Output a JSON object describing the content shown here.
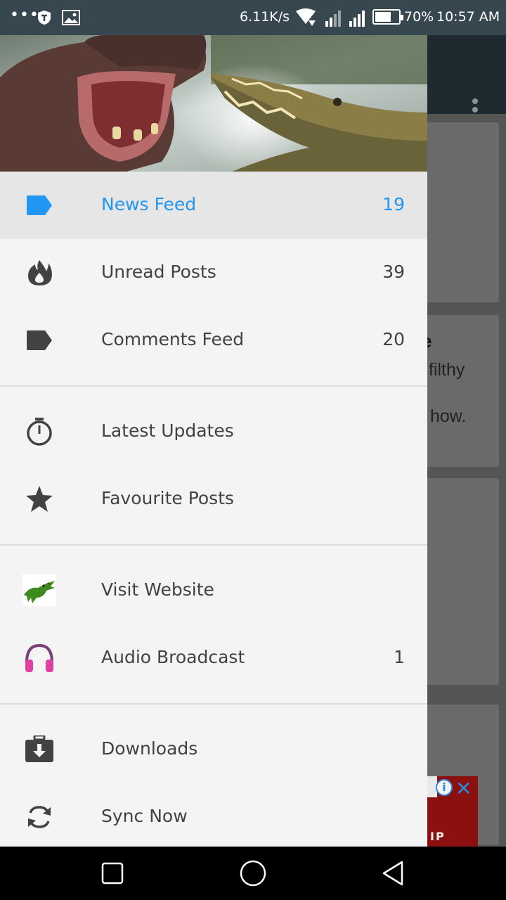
{
  "status_bar": {
    "dots": "•••",
    "network_speed": "6.11K/s",
    "battery_percent": "70%",
    "battery_level": 0.7,
    "time": "10:57 AM"
  },
  "drawer": {
    "groups": [
      [
        {
          "label": "News Feed",
          "count": "19",
          "icon": "label-tag-icon",
          "active": true
        },
        {
          "label": "Unread Posts",
          "count": "39",
          "icon": "flame-icon"
        },
        {
          "label": "Comments Feed",
          "count": "20",
          "icon": "label-tag-icon"
        }
      ],
      [
        {
          "label": "Latest Updates",
          "count": "",
          "icon": "stopwatch-icon"
        },
        {
          "label": "Favourite Posts",
          "count": "",
          "icon": "star-icon"
        }
      ],
      [
        {
          "label": "Visit Website",
          "count": "",
          "icon": "crocodile-icon"
        },
        {
          "label": "Audio Broadcast",
          "count": "1",
          "icon": "headphones-icon"
        }
      ],
      [
        {
          "label": "Downloads",
          "count": "",
          "icon": "download-box-icon"
        },
        {
          "label": "Sync Now",
          "count": "",
          "icon": "sync-icon"
        }
      ]
    ]
  },
  "background": {
    "card2_title_fragment": "e",
    "card2_line1_fragment": "filthy",
    "card2_line2_fragment": "how.",
    "ad_text": "IP"
  },
  "colors": {
    "accent": "#2196f3",
    "status_bar": "#37474f",
    "drawer_bg": "#f4f4f4",
    "headphones": "#e040a0",
    "crocodile": "#3f8a1f"
  }
}
